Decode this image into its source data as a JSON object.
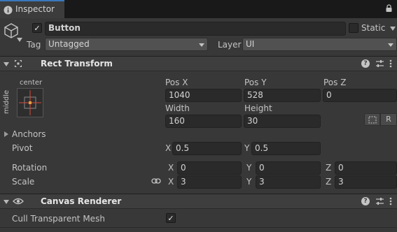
{
  "tab": {
    "title": "Inspector"
  },
  "object": {
    "name": "Button",
    "static_label": "Static",
    "tag_label": "Tag",
    "tag_value": "Untagged",
    "layer_label": "Layer",
    "layer_value": "UI"
  },
  "rect_transform": {
    "title": "Rect Transform",
    "anchor_preset_h": "center",
    "anchor_preset_v": "middle",
    "pos_x_label": "Pos X",
    "pos_x": "1040",
    "pos_y_label": "Pos Y",
    "pos_y": "528",
    "pos_z_label": "Pos Z",
    "pos_z": "0",
    "width_label": "Width",
    "width": "160",
    "height_label": "Height",
    "height": "30",
    "raw_button": "R",
    "anchors_label": "Anchors",
    "pivot_label": "Pivot",
    "pivot_x_label": "X",
    "pivot_x": "0.5",
    "pivot_y_label": "Y",
    "pivot_y": "0.5",
    "rotation_label": "Rotation",
    "rot_x_label": "X",
    "rot_x": "0",
    "rot_y_label": "Y",
    "rot_y": "0",
    "rot_z_label": "Z",
    "rot_z": "0",
    "scale_label": "Scale",
    "scale_x_label": "X",
    "scale_x": "3",
    "scale_y_label": "Y",
    "scale_y": "3",
    "scale_z_label": "Z",
    "scale_z": "3"
  },
  "canvas_renderer": {
    "title": "Canvas Renderer",
    "cull_label": "Cull Transparent Mesh"
  },
  "icons": {
    "help": "?",
    "check": "✓"
  },
  "colors": {
    "background": "#383838",
    "tab_accent": "#3a79bb",
    "field": "#2a2a2a",
    "anchor_red": "#d84a3a",
    "anchor_orange": "#e0a040"
  }
}
